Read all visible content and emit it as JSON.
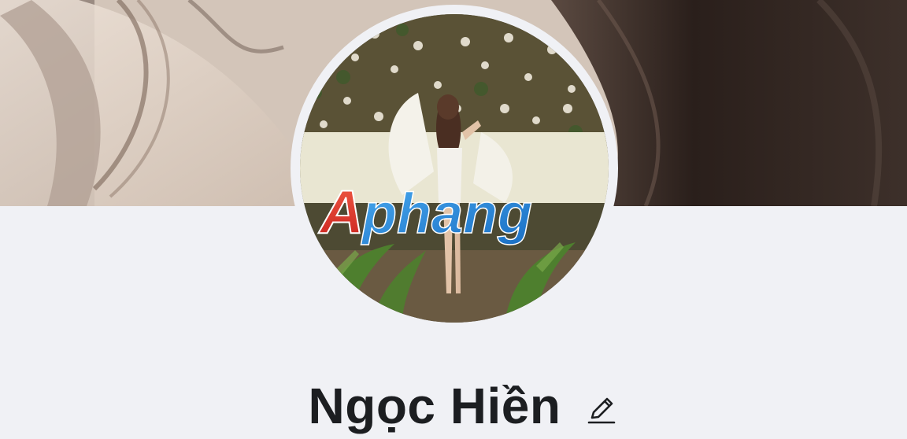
{
  "profile": {
    "name": "Ngọc Hiền",
    "edit_icon": "pencil-icon",
    "watermark_text": "Aphang"
  },
  "colors": {
    "background": "#f0f1f5",
    "name_text": "#1c1e21",
    "watermark_red": "#e8392e",
    "watermark_blue": "#2f8fdc"
  }
}
